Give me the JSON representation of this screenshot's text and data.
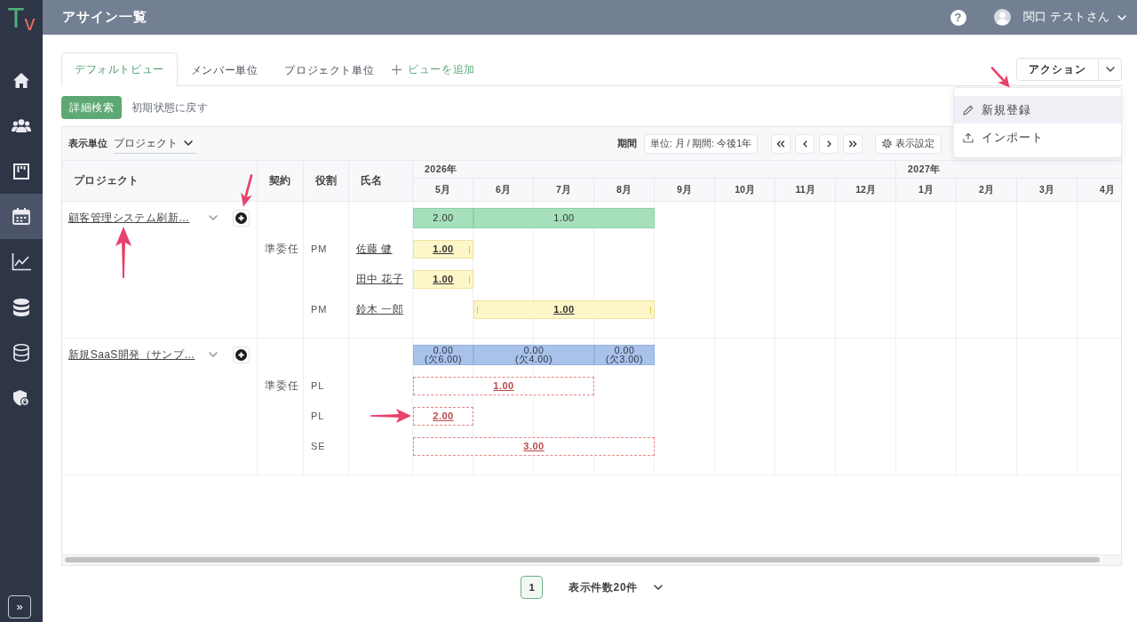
{
  "sidebar": {
    "logo": [
      "T",
      "v"
    ],
    "items": [
      {
        "kind": "home",
        "selected": false
      },
      {
        "kind": "members",
        "selected": false
      },
      {
        "kind": "board",
        "selected": false
      },
      {
        "kind": "calendar",
        "selected": true
      },
      {
        "kind": "chart",
        "selected": false
      },
      {
        "kind": "database",
        "selected": false
      },
      {
        "kind": "records",
        "selected": false
      },
      {
        "kind": "security",
        "selected": false
      }
    ],
    "expand_button": "»"
  },
  "header": {
    "title": "アサイン一覧",
    "help": "?",
    "user": "関口 テストさん"
  },
  "tabs": [
    {
      "label": "デフォルトビュー",
      "selected": true
    },
    {
      "label": "メンバー単位",
      "selected": false
    },
    {
      "label": "プロジェクト単位",
      "selected": false
    }
  ],
  "add_view": "ビューを追加",
  "action_button": "アクション",
  "action_menu": [
    {
      "label": "新規登録",
      "kind": "edit",
      "highlighted": true,
      "pointed_at": true
    },
    {
      "label": "インポート",
      "kind": "import",
      "highlighted": false
    }
  ],
  "filters": {
    "search_button": "詳細検索",
    "reset_link": "初期状態に戻す"
  },
  "toolbar": {
    "unit_label": "表示単位",
    "unit_value": "プロジェクト",
    "period_label": "期間",
    "period_value": "単位: 月 / 期間: 今後1年",
    "settings_button": "表示設定"
  },
  "table": {
    "columns": [
      "プロジェクト",
      "契約",
      "役割",
      "氏名"
    ],
    "months": [
      {
        "label": "5月",
        "year": "2026年"
      },
      {
        "label": "6月"
      },
      {
        "label": "7月"
      },
      {
        "label": "8月"
      },
      {
        "label": "9月"
      },
      {
        "label": "10月"
      },
      {
        "label": "11月"
      },
      {
        "label": "12月"
      },
      {
        "label": "1月",
        "year": "2027年"
      },
      {
        "label": "2月"
      },
      {
        "label": "3月"
      },
      {
        "label": "4月"
      }
    ],
    "projects": [
      {
        "name": "顧客管理システム刷新…",
        "name_pointed_at": true,
        "add_button_pointed_at": true,
        "contract": "準委任",
        "summary": [
          {
            "kind": "bar",
            "value": "2.00",
            "shortage": false
          },
          {
            "kind": "bar",
            "value": "1.00",
            "shortage": false
          },
          {
            "kind": "continued"
          },
          {
            "kind": "continued"
          }
        ],
        "members": [
          {
            "role": "PM",
            "name": "佐藤 健",
            "assigned": true,
            "months": [
              {
                "kind": "bar",
                "value": "1.00"
              }
            ]
          },
          {
            "name": "田中 花子",
            "assigned": true,
            "months": [
              {
                "kind": "bar",
                "value": "1.00"
              }
            ]
          },
          {
            "role": "PM",
            "name": "鈴木 一郎",
            "assigned": true,
            "months": [
              {
                "kind": "empty"
              },
              {
                "kind": "bar",
                "value": "1.00"
              },
              {
                "kind": "continued"
              },
              {
                "kind": "continued"
              }
            ]
          }
        ]
      },
      {
        "name": "新規SaaS開発（サンプ…",
        "contract": "準委任",
        "summary": [
          {
            "kind": "bar",
            "value": "0.00",
            "note": "(欠6.00)",
            "shortage": true
          },
          {
            "kind": "bar",
            "value": "0.00",
            "note": "(欠4.00)",
            "shortage": true
          },
          {
            "kind": "continued"
          },
          {
            "kind": "bar",
            "value": "0.00",
            "note": "(欠3.00)",
            "shortage": true
          }
        ],
        "members": [
          {
            "role": "PL",
            "assigned": false,
            "months": [
              {
                "kind": "bar",
                "value": "1.00"
              },
              {
                "kind": "continued"
              },
              {
                "kind": "continued"
              }
            ]
          },
          {
            "role": "PL",
            "assigned": false,
            "bar_pointed_at": true,
            "months": [
              {
                "kind": "bar",
                "value": "2.00"
              }
            ]
          },
          {
            "role": "SE",
            "assigned": false,
            "months": [
              {
                "kind": "bar",
                "value": "3.00"
              },
              {
                "kind": "continued"
              },
              {
                "kind": "continued"
              },
              {
                "kind": "continued"
              }
            ]
          }
        ]
      }
    ]
  },
  "pagination": {
    "pages": [
      {
        "label": "1",
        "selected": true
      }
    ],
    "page_size": "表示件数20件"
  }
}
